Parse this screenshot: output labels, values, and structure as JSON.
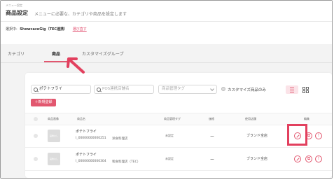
{
  "header": {
    "breadcrumb": "メニュー設定",
    "title": "商品設定",
    "subtitle": "メニューに必要な、カテゴリや商品を設定します",
    "selected_label": "選択中:",
    "selected_name": "ShowcaceGig（TEC連携）",
    "change_link": "選び直す"
  },
  "tabs": [
    {
      "label": "カテゴリ",
      "active": false
    },
    {
      "label": "商品",
      "active": true
    },
    {
      "label": "カスタマイズグループ",
      "active": false
    }
  ],
  "filters": {
    "search_value": "ポテトフライ",
    "pos_placeholder": "POS連携店舗名",
    "tag_placeholder": "商品管理タグ",
    "customize_only_label": "カスタマイズ商品のみ"
  },
  "add_button": "＋新規登録",
  "columns": [
    "商品画像",
    "商品名",
    "商品管理タグ",
    "価格",
    "使用店舗",
    "編集"
  ],
  "rows": [
    {
      "thumb": "画像なし",
      "name": "ポテトフライ",
      "code": "I_00000000000251",
      "category": "洋食料理店",
      "tag": "未設定",
      "price": "ー",
      "stores": "ブランド全店"
    },
    {
      "thumb": "画像なし",
      "name": "ポテトフライ",
      "code": "I_00000000000304",
      "category": "和食料理店（TEC）",
      "tag": "未設定",
      "price": "ー",
      "stores": "ブランド全店"
    }
  ],
  "colors": {
    "accent": "#e2576f",
    "highlight": "#e2405e"
  }
}
